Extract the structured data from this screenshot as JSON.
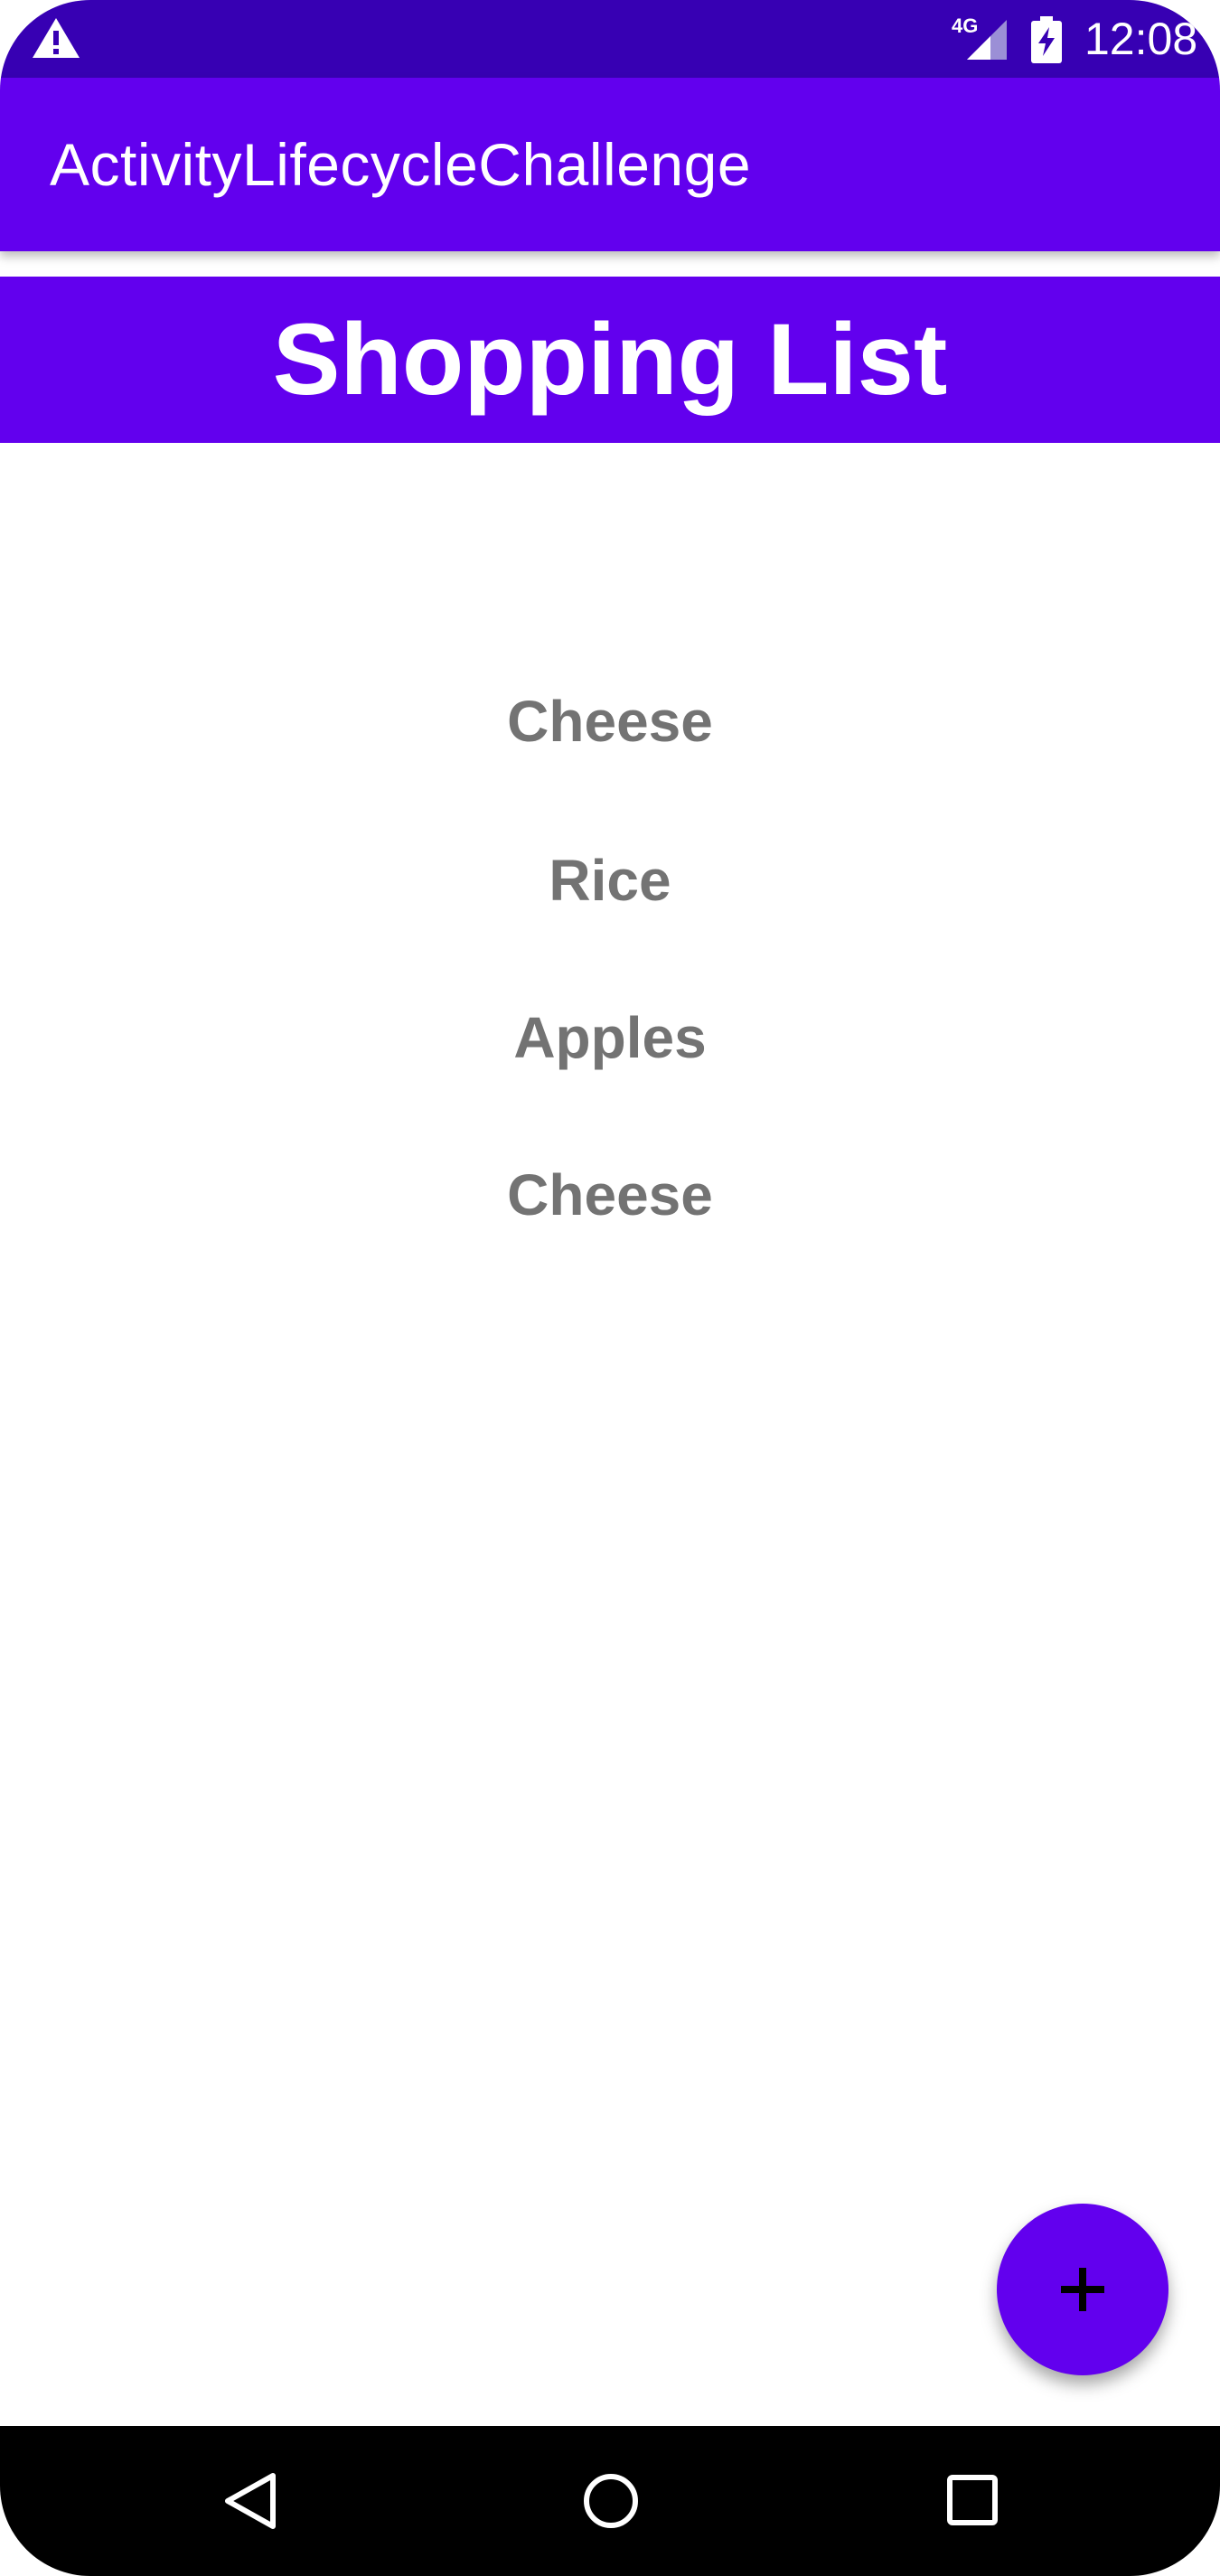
{
  "status_bar": {
    "network_type": "4G",
    "clock": "12:08",
    "icons": [
      "warning-icon",
      "signal-icon",
      "battery-charging-icon"
    ]
  },
  "app_bar": {
    "title": "ActivityLifecycleChallenge"
  },
  "list": {
    "header": "Shopping List",
    "items": [
      "Cheese",
      "Rice",
      "Apples",
      "Cheese"
    ]
  },
  "fab": {
    "icon": "plus-icon"
  },
  "nav_bar": {
    "icons": [
      "back-icon",
      "home-icon",
      "recents-icon"
    ]
  },
  "colors": {
    "status_bar": "#3700B3",
    "primary": "#6200EE",
    "item_text": "#737373",
    "nav_bar": "#000000"
  }
}
